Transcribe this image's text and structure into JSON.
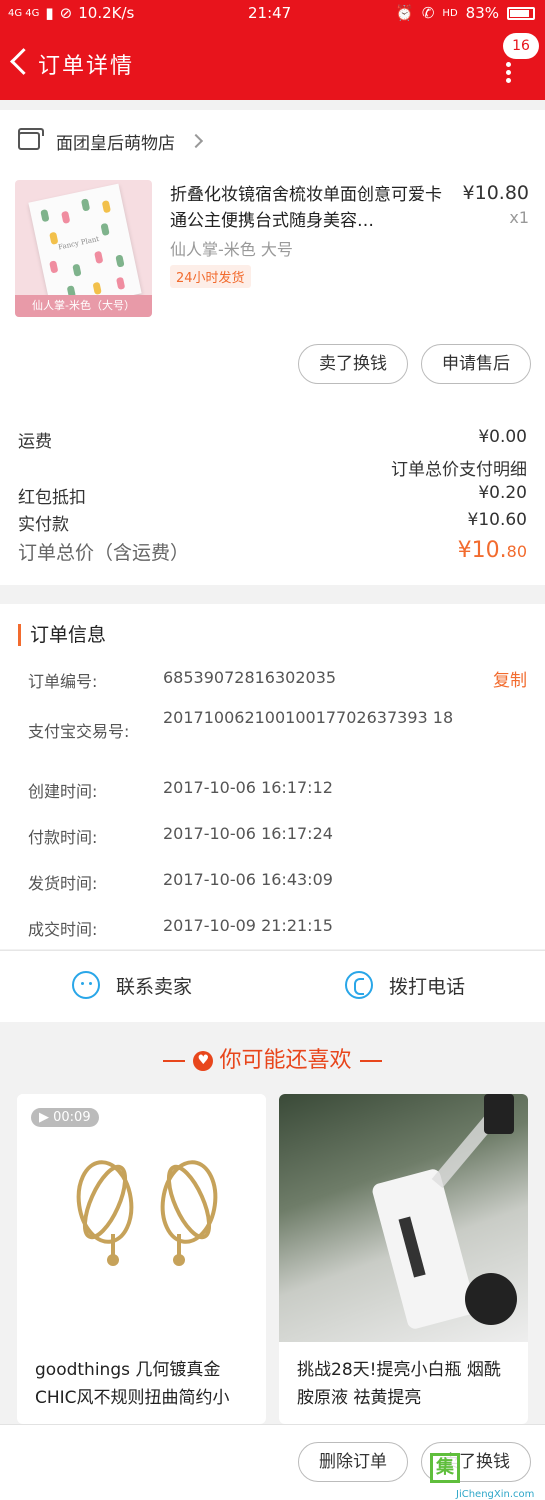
{
  "status_bar": {
    "network": "4G 4G",
    "speed": "10.2K/s",
    "time": "21:47",
    "hd": "HD",
    "battery": "83%"
  },
  "header": {
    "title": "订单详情",
    "badge_count": "16"
  },
  "shop": {
    "name": "面团皇后萌物店"
  },
  "product": {
    "title": "折叠化妆镜宿舍梳妆单面创意可爱卡通公主便携台式随身美容…",
    "price": "¥10.80",
    "qty": "x1",
    "variant": "仙人掌-米色 大号",
    "tag": "24小时发货",
    "image_caption": "仙人掌-米色（大号）",
    "image_title": "Fancy Plant"
  },
  "product_actions": {
    "exchange": "卖了换钱",
    "after_sale": "申请售后"
  },
  "fees": {
    "shipping_label": "运费",
    "shipping_value": "¥0.00",
    "detail_link": "订单总价支付明细",
    "redpacket_label": "红包抵扣",
    "redpacket_value": "¥0.20",
    "paid_label": "实付款",
    "paid_value": "¥10.60",
    "total_label": "订单总价（含运费）",
    "total_int": "¥10.",
    "total_dec": "80"
  },
  "order_info": {
    "title": "订单信息",
    "copy": "复制",
    "rows": [
      {
        "label": "订单编号:",
        "value": "68539072816302035"
      },
      {
        "label": "支付宝交易号:",
        "value": "20171006210010017702637393 18"
      },
      {
        "label": "创建时间:",
        "value": "2017-10-06 16:17:12"
      },
      {
        "label": "付款时间:",
        "value": "2017-10-06 16:17:24"
      },
      {
        "label": "发货时间:",
        "value": "2017-10-06 16:43:09"
      },
      {
        "label": "成交时间:",
        "value": "2017-10-09 21:21:15"
      }
    ]
  },
  "contact": {
    "seller": "联系卖家",
    "phone": "拨打电话"
  },
  "recommend": {
    "title": "你可能还喜欢",
    "items": [
      {
        "video": "▶ 00:09",
        "text": "goodthings 几何镀真金CHIC风不规则扭曲简约小"
      },
      {
        "text": "挑战28天!提亮小白瓶 烟酰胺原液 祛黄提亮"
      }
    ]
  },
  "bottom_actions": {
    "delete": "删除订单",
    "exchange": "卖了换钱"
  },
  "watermark": {
    "mark": "集",
    "brand": "JiChengXin.com"
  },
  "colors": {
    "brand_red": "#e8141c",
    "accent_orange": "#f26b2e",
    "icon_blue": "#29a6e8"
  }
}
